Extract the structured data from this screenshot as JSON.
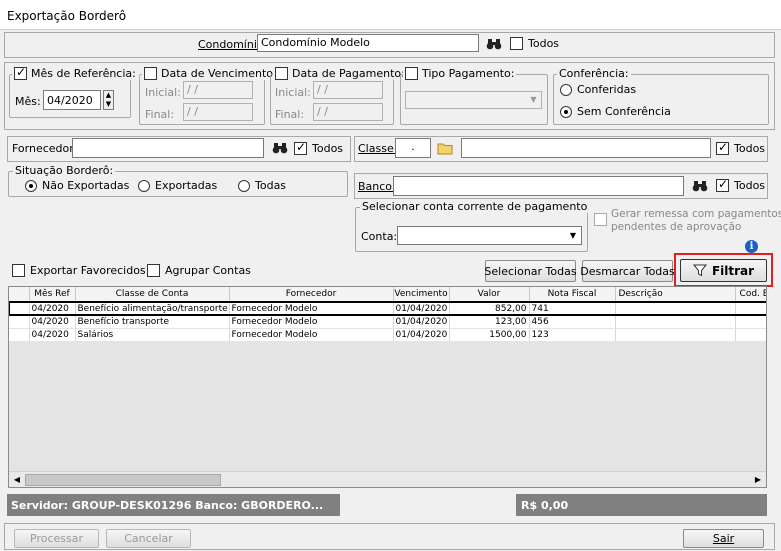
{
  "window": {
    "title": "Exportação Borderô"
  },
  "condominio": {
    "label": "Condomínio:",
    "value": "Condomínio Modelo",
    "todos_label": "Todos",
    "todos_checked": false
  },
  "mes_referencia": {
    "label": "Mês de Referência:",
    "checked": true,
    "mes_label": "Mês:",
    "value": "04/2020"
  },
  "data_vencimento": {
    "label": "Data de Vencimento:",
    "checked": false,
    "inicial_label": "Inicial:",
    "inicial_value": " / /",
    "final_label": "Final:",
    "final_value": " / /"
  },
  "data_pagamento": {
    "label": "Data de Pagamento:",
    "checked": false,
    "inicial_label": "Inicial:",
    "inicial_value": " / /",
    "final_label": "Final:",
    "final_value": " / /"
  },
  "tipo_pagamento": {
    "label": "Tipo Pagamento:",
    "checked": false,
    "value": ""
  },
  "conferencia": {
    "label": "Conferência:",
    "options": [
      "Conferidas",
      "Sem Conferência"
    ],
    "selected": "Sem Conferência"
  },
  "fornecedor": {
    "label": "Fornecedor:",
    "value": "",
    "todos_label": "Todos",
    "todos_checked": true
  },
  "classe": {
    "label": "Classe:",
    "code": ".",
    "value": "",
    "todos_label": "Todos",
    "todos_checked": true
  },
  "situacao": {
    "label": "Situação Borderô:",
    "options": [
      "Não Exportadas",
      "Exportadas",
      "Todas"
    ],
    "selected": "Não Exportadas"
  },
  "banco": {
    "label": "Banco:",
    "value": "",
    "todos_label": "Todos",
    "todos_checked": true
  },
  "conta_pagamento": {
    "label": "Selecionar conta corrente de pagamento",
    "conta_label": "Conta:",
    "value": ""
  },
  "gerar_remessa": {
    "label_line1": "Gerar remessa com pagamentos",
    "label_line2": "pendentes de aprovação",
    "checked": false
  },
  "options": {
    "exportar_favorecidos": "Exportar Favorecidos",
    "agrupar_contas": "Agrupar Contas"
  },
  "actions": {
    "selecionar_todas": "Selecionar Todas",
    "desmarcar_todas": "Desmarcar Todas",
    "filtrar": "Filtrar"
  },
  "grid": {
    "columns": [
      "",
      "Mês Ref",
      "Classe de Conta",
      "Fornecedor",
      "Vencimento",
      "Valor",
      "Nota Fiscal",
      "Descrição",
      "Cod. Ba"
    ],
    "rows": [
      {
        "mes": "04/2020",
        "classe": "Benefício alimentação/transporte",
        "fornecedor": "Fornecedor Modelo",
        "vencimento": "01/04/2020",
        "valor": "852,00",
        "nf": "741",
        "descricao": ""
      },
      {
        "mes": "04/2020",
        "classe": "Benefício transporte",
        "fornecedor": "Fornecedor Modelo",
        "vencimento": "01/04/2020",
        "valor": "123,00",
        "nf": "456",
        "descricao": ""
      },
      {
        "mes": "04/2020",
        "classe": "Salários",
        "fornecedor": "Fornecedor Modelo",
        "vencimento": "01/04/2020",
        "valor": "1500,00",
        "nf": "123",
        "descricao": ""
      }
    ]
  },
  "status": {
    "server": "Servidor: GROUP-DESK01296 Banco: GBORDERO...",
    "total": "R$ 0,00"
  },
  "footer": {
    "processar": "Processar",
    "cancelar": "Cancelar",
    "sair": "Sair"
  },
  "icons": {
    "binoculars": "binoculars-icon",
    "folder": "folder-icon",
    "info": "info-icon",
    "filter": "filter-icon"
  },
  "colors": {
    "highlight_border": "#e02020",
    "status_bg": "#808080",
    "info_blue": "#1a5fc8"
  }
}
